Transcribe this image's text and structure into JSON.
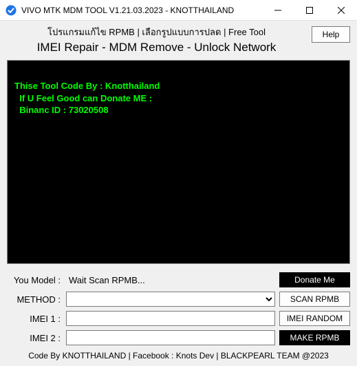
{
  "titlebar": {
    "title": "VIVO MTK MDM TOOL V1.21.03.2023 - KNOTTHAILAND"
  },
  "header": {
    "line1": "โปรแกรมแก้ไข RPMB | เลือกรูปแบบการปลด | Free Tool",
    "line2": "IMEI Repair - MDM Remove - Unlock Network",
    "help_label": "Help"
  },
  "console": {
    "line1": "Thise Tool Code By : Knotthailand",
    "line2": "  If U Feel Good can Donate ME :",
    "line3": "  Binanc ID : 73020508"
  },
  "form": {
    "model_label": "You Model  :",
    "scan_status": "Wait Scan RPMB...",
    "donate_label": "Donate Me",
    "method_label": "METHOD :",
    "method_value": "",
    "scan_label": "SCAN RPMB",
    "imei1_label": "IMEI 1 :",
    "imei1_value": "",
    "random_label": "IMEI RANDOM",
    "imei2_label": "IMEI 2 :",
    "imei2_value": "",
    "make_label": "MAKE RPMB"
  },
  "footer": {
    "text": "Code By KNOTTHAILAND | Facebook : Knots Dev | BLACKPEARL TEAM @2023"
  }
}
